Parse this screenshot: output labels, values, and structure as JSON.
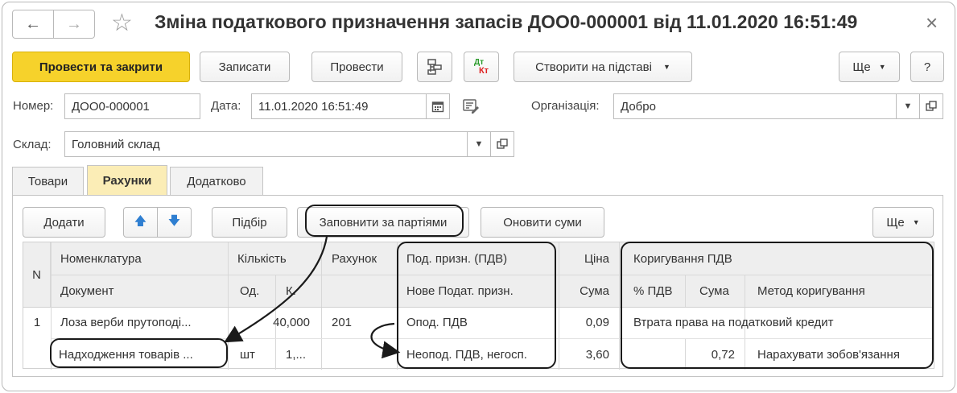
{
  "window": {
    "back_glyph": "←",
    "forward_glyph": "→",
    "favorite_glyph": "☆",
    "title": "Зміна податкового призначення запасів ДОО0-000001 від 11.01.2020 16:51:49",
    "close_glyph": "×"
  },
  "toolbar": {
    "post_close": "Провести та закрити",
    "save": "Записати",
    "post": "Провести",
    "dt_label": "Дт",
    "kt_label": "Кт",
    "create_based": "Створити на підставі",
    "more": "Ще",
    "help": "?"
  },
  "header": {
    "number_label": "Номер:",
    "number_value": "ДОО0-000001",
    "date_label": "Дата:",
    "date_value": "11.01.2020 16:51:49",
    "org_label": "Організація:",
    "org_value": "Добро",
    "warehouse_label": "Склад:",
    "warehouse_value": "Головний склад"
  },
  "tabs": {
    "goods": "Товари",
    "accounts": "Рахунки",
    "additional": "Додатково"
  },
  "table_toolbar": {
    "add": "Додати",
    "up_glyph": "🡅",
    "down_glyph": "🡇",
    "pick": "Підбір",
    "fill_by_batches": "Заповнити за партіями",
    "update_sums": "Оновити суми",
    "more": "Ще"
  },
  "table": {
    "headers": {
      "n": "N",
      "nomenclature": "Номенклатура",
      "document": "Документ",
      "quantity": "Кількість",
      "unit": "Од.",
      "coef": "К.",
      "account": "Рахунок",
      "tax_purpose": "Под. призн. (ПДВ)",
      "new_tax_purpose": "Нове Подат. призн.",
      "price": "Ціна",
      "sum": "Сума",
      "vat_correction": "Коригування ПДВ",
      "vat_percent": "% ПДВ",
      "vat_sum": "Сума",
      "correction_method": "Метод коригування"
    },
    "row": {
      "n": "1",
      "nomenclature": "Лоза верби прутоподі...",
      "document": "Надходження товарів ...",
      "quantity": "40,000",
      "unit": "шт",
      "coef": "1,...",
      "account": "201",
      "tax_purpose": "Опод. ПДВ",
      "new_tax_purpose": "Неопод. ПДВ, негосп.",
      "price": "0,09",
      "sum": "3,60",
      "vat_correction": "Втрата права на податковий кредит",
      "vat_percent": "",
      "vat_sum": "0,72",
      "correction_method": "Нарахувати зобов'язання"
    }
  },
  "colors": {
    "accent_yellow": "#f6d22b",
    "active_tab": "#fbedb6",
    "arrow_blue": "#2f7fd1",
    "header_gray": "#eeeeee"
  }
}
